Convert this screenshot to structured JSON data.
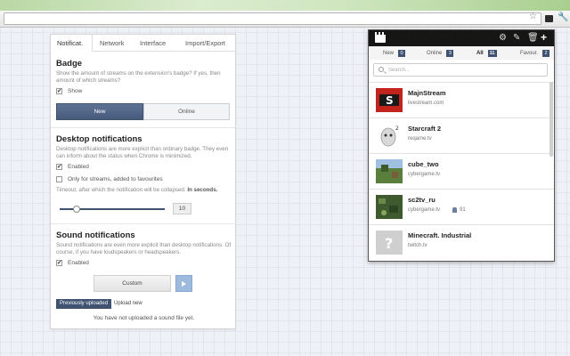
{
  "browser": {
    "icons": [
      "star-icon",
      "extension-icon",
      "wrench-icon"
    ]
  },
  "options": {
    "tabs": [
      {
        "label": "Notificat.",
        "active": true
      },
      {
        "label": "Network",
        "active": false
      },
      {
        "label": "Interface",
        "active": false
      },
      {
        "label": "Import/Export",
        "active": false
      }
    ],
    "badge": {
      "title": "Badge",
      "description": "Show the amount of streams on the extension's badge? If yes, then amount of which streams?",
      "show_label": "Show",
      "show_checked": true,
      "segments": [
        {
          "label": "New",
          "selected": true
        },
        {
          "label": "Online",
          "selected": false
        }
      ]
    },
    "desktop": {
      "title": "Desktop notifications",
      "description": "Desktop notifications are more explicit than ordinary badge. They even can inform about the status when Chrome is minimized.",
      "enabled_label": "Enabled",
      "enabled_checked": true,
      "favourites_label": "Only for streams, added to favourites",
      "favourites_checked": false,
      "timeout_label": "Timeout, after which the notification will be collapsed.",
      "timeout_unit": "In seconds.",
      "timeout_value": "10",
      "slider_fraction": 0.16
    },
    "sound": {
      "title": "Sound notifications",
      "description": "Sound notifications are even more explicit than desktop notifications. Of course, if you have loudspeakers or headspeakers.",
      "enabled_label": "Enabled",
      "enabled_checked": true,
      "custom_label": "Custom",
      "previously_uploaded_label": "Previously uploaded",
      "upload_new_label": "Upload new",
      "no_sound_text": "You have not uploaded a sound file yet."
    }
  },
  "popup": {
    "toolbar_icons": [
      "clapperboard-icon",
      "gear-icon",
      "pencil-icon",
      "trash-icon",
      "plus-icon"
    ],
    "filters": [
      {
        "label": "New",
        "count": "0",
        "active": false
      },
      {
        "label": "Online",
        "count": "3",
        "active": false
      },
      {
        "label": "All",
        "count": "11",
        "active": true
      },
      {
        "label": "Favour.",
        "count": "2",
        "active": false
      }
    ],
    "search_placeholder": "Search...",
    "streams": [
      {
        "name": "MajnStream",
        "site": "livestream.com",
        "viewers": "",
        "thumb_color": "#c2241d"
      },
      {
        "name": "Starcraft 2",
        "site": "reqame.tv",
        "viewers": "",
        "thumb_color": "#e8e8e8"
      },
      {
        "name": "cube_two",
        "site": "cybergame.tv",
        "viewers": "",
        "thumb_color": "#6b8f4a"
      },
      {
        "name": "sc2tv_ru",
        "site": "cybergame.tv",
        "viewers": "91",
        "thumb_color": "#4f6b3a"
      },
      {
        "name": "Minecraft. Industrial",
        "site": "twitch.tv",
        "viewers": "",
        "thumb_color": "#cfcfcf"
      }
    ]
  }
}
